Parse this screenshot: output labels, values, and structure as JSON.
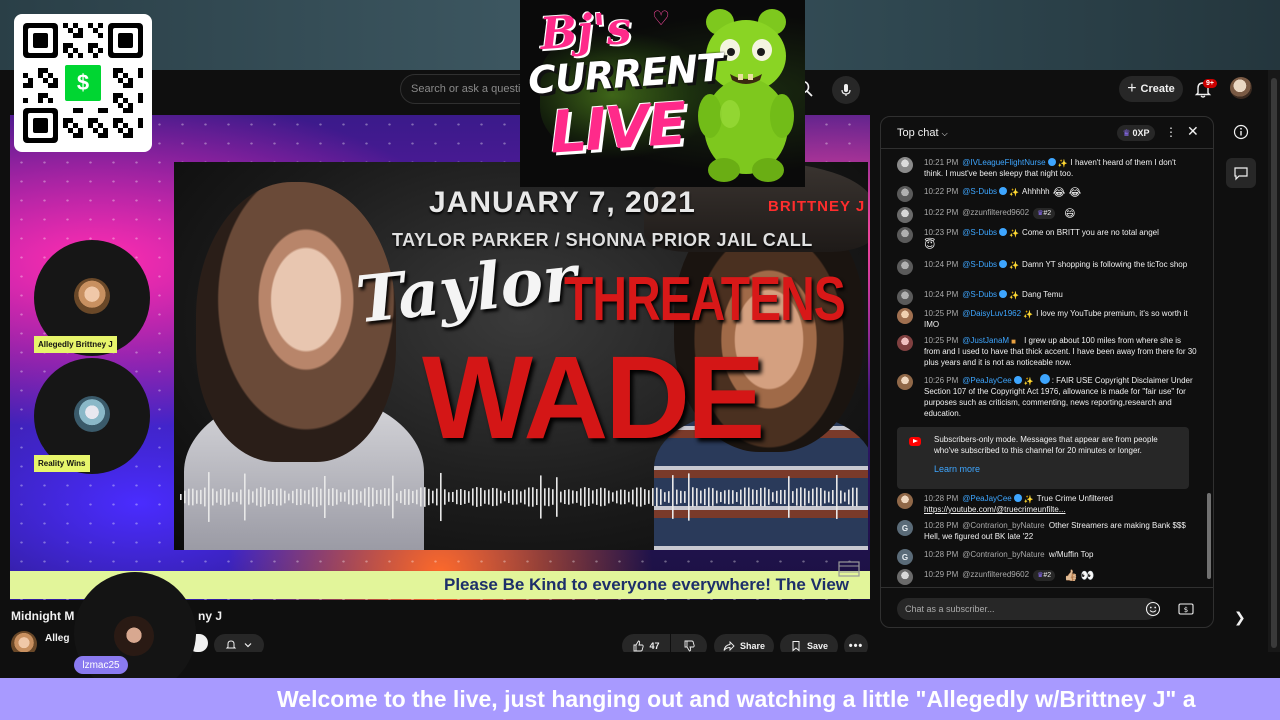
{
  "header": {
    "search_placeholder": "Search or ask a question",
    "create_label": "Create",
    "notification_count": "9+"
  },
  "video": {
    "thumbnail": {
      "date": "JANUARY 7, 2021",
      "subtitle": "TAYLOR PARKER / SHONNA PRIOR JAIL CALL",
      "brand": "BRITTNEY J",
      "taylor": "Taylor",
      "threatens": "THREATENS",
      "wade": "WADE"
    },
    "guests": [
      {
        "label": "Allegedly Brittney J"
      },
      {
        "label": "Reality Wins"
      }
    ],
    "ticker": "Please Be Kind to everyone everywhere! The View",
    "title_start": "Midnight M",
    "title_end": "ny J",
    "channel_name": "Alleg",
    "like_count": "47",
    "share_label": "Share",
    "save_label": "Save"
  },
  "chat": {
    "mode_label": "Top chat",
    "xp_label": "0XP",
    "messages": [
      {
        "time": "10:21 PM",
        "author": "@IVLeagueFlightNurse",
        "text": "I haven't heard of them I don't think. I must've been sleepy that night too."
      },
      {
        "time": "10:22 PM",
        "author": "@S-Dubs",
        "text": "Ahhhhh",
        "emoji": "😂 😂"
      },
      {
        "time": "10:22 PM",
        "author": "@zzunfiltered9602",
        "rank": "#2",
        "emoji": "😄"
      },
      {
        "time": "10:23 PM",
        "author": "@S-Dubs",
        "text": "Come on BRITT you are no total angel",
        "emoji": "😇"
      },
      {
        "time": "10:24 PM",
        "author": "@S-Dubs",
        "text": "Damn YT shopping is following the ticToc shop"
      },
      {
        "time": "10:24 PM",
        "author": "@S-Dubs",
        "text": "Dang Temu"
      },
      {
        "time": "10:25 PM",
        "author": "@DaisyLuv1962",
        "text": "I love my YouTube premium, it's so worth it IMO"
      },
      {
        "time": "10:25 PM",
        "author": "@JustJanaM",
        "text": "I grew up about 100 miles from where she is from and I used to have that thick accent. I have been away from there for 30 plus years and it is not as noticeable now."
      },
      {
        "time": "10:26 PM",
        "author": "@PeaJayCee",
        "text": ": FAIR USE Copyright Disclaimer Under Section 107 of the Copyright Act 1976, allowance is made for \"fair use\" for purposes such as criticism, commenting, news reporting,research and education."
      },
      {
        "time": "10:28 PM",
        "author": "@PeaJayCee",
        "text": "True Crime Unfiltered",
        "link": "https://youtube.com/@truecrimeunfilte..."
      },
      {
        "time": "10:28 PM",
        "author": "@Contrarion_byNature",
        "text": "Other Streamers are making Bank $$$ Hell, we figured out BK late '22"
      },
      {
        "time": "10:28 PM",
        "author": "@Contrarion_byNature",
        "text": "w/Muffin Top"
      },
      {
        "time": "10:29 PM",
        "author": "@zzunfiltered9602",
        "rank": "#2",
        "emoji": "👍🏼 👀"
      }
    ],
    "subscriber_notice": "Subscribers-only mode. Messages that appear are from people who've subscribed to this channel for 20 minutes or longer.",
    "learn_more": "Learn more",
    "input_placeholder": "Chat as a subscriber..."
  },
  "overlay": {
    "cashapp_symbol": "$",
    "logo_top": "Bj's",
    "logo_middle": "CURRENT",
    "logo_bottom": "LIVE",
    "cam_label": "lzmac25",
    "welcome_ticker": "Welcome to the live, just hanging out and watching a little \"Allegedly w/Brittney J\" a"
  },
  "colors": {
    "accent_blue": "#3ea6ff",
    "ticker_bg": "#e2f59a",
    "welcome_bg": "#a89aff",
    "guest_label_bg": "#e7f56b",
    "logo_pink": "#ff2a8a",
    "cashapp_green": "#00d632"
  }
}
